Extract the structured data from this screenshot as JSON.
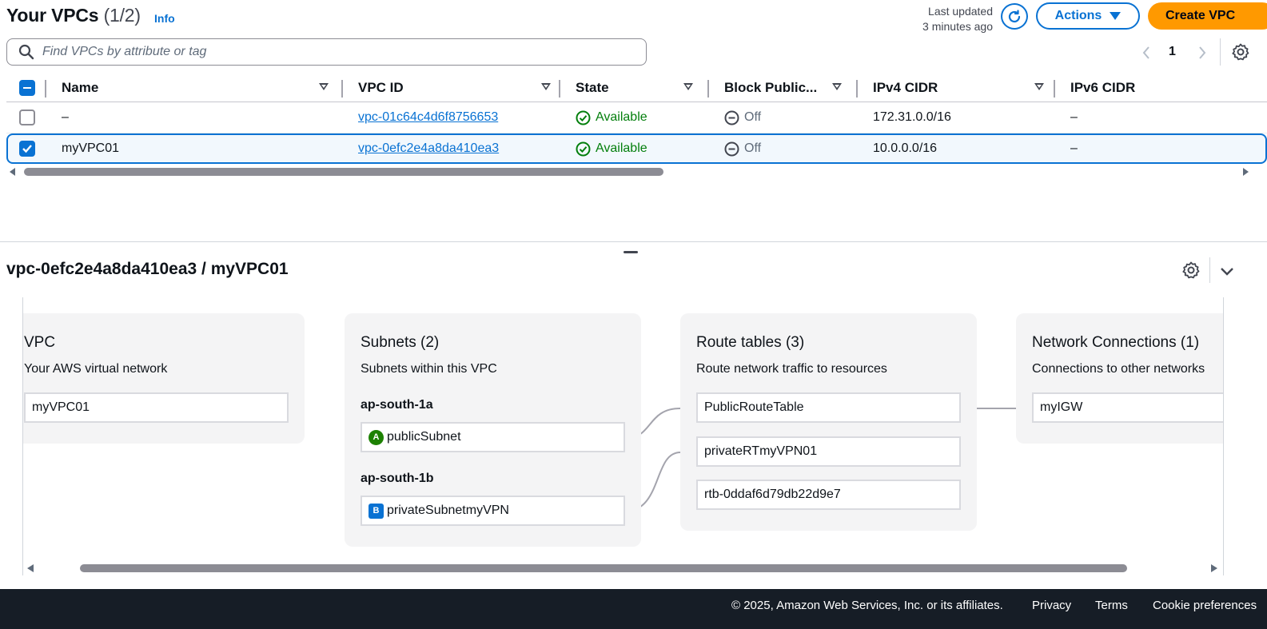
{
  "header": {
    "title": "Your VPCs",
    "count": "(1/2)",
    "info": "Info",
    "last_updated_line1": "Last updated",
    "last_updated_line2": "3 minutes ago",
    "actions_label": "Actions",
    "create_label": "Create VPC"
  },
  "search": {
    "placeholder": "Find VPCs by attribute or tag",
    "value": ""
  },
  "pagination": {
    "current_page": "1"
  },
  "table": {
    "columns": [
      "Name",
      "VPC ID",
      "State",
      "Block Public...",
      "IPv4 CIDR",
      "IPv6 CIDR"
    ],
    "rows": [
      {
        "selected": false,
        "name": "–",
        "vpc_id": "vpc-01c64c4d6f8756653",
        "state": "Available",
        "block_public": "Off",
        "ipv4": "172.31.0.0/16",
        "ipv6": "–"
      },
      {
        "selected": true,
        "name": "myVPC01",
        "vpc_id": "vpc-0efc2e4a8da410ea3",
        "state": "Available",
        "block_public": "Off",
        "ipv4": "10.0.0.0/16",
        "ipv6": "–"
      }
    ]
  },
  "detail": {
    "title": "vpc-0efc2e4a8da410ea3 / myVPC01",
    "resource_map": {
      "vpc": {
        "title": "VPC",
        "subtitle": "Your AWS virtual network",
        "nodes": [
          "myVPC01"
        ]
      },
      "subnets": {
        "title": "Subnets (2)",
        "subtitle": "Subnets within this VPC",
        "groups": [
          {
            "az": "ap-south-1a",
            "badge": "A",
            "subnet": "publicSubnet"
          },
          {
            "az": "ap-south-1b",
            "badge": "B",
            "subnet": "privateSubnetmyVPN"
          }
        ]
      },
      "route_tables": {
        "title": "Route tables (3)",
        "subtitle": "Route network traffic to resources",
        "nodes": [
          "PublicRouteTable",
          "privateRTmyVPN01",
          "rtb-0ddaf6d79db22d9e7"
        ]
      },
      "network_connections": {
        "title": "Network Connections (1)",
        "subtitle": "Connections to other networks",
        "nodes": [
          "myIGW"
        ]
      }
    }
  },
  "footer": {
    "copyright": "© 2025, Amazon Web Services, Inc. or its affiliates.",
    "links": [
      "Privacy",
      "Terms",
      "Cookie preferences"
    ]
  },
  "colors": {
    "accent": "#0972d3",
    "create_button": "#ff9900",
    "status_ok": "#037f0c",
    "footer_bg": "#161d26"
  },
  "icons": [
    "search-icon",
    "refresh-icon",
    "caret-down-icon",
    "chevron-left-icon",
    "chevron-right-icon",
    "gear-icon",
    "sort-icon",
    "checkbox-icon",
    "status-ok-icon",
    "status-off-icon",
    "chevron-down-icon"
  ]
}
